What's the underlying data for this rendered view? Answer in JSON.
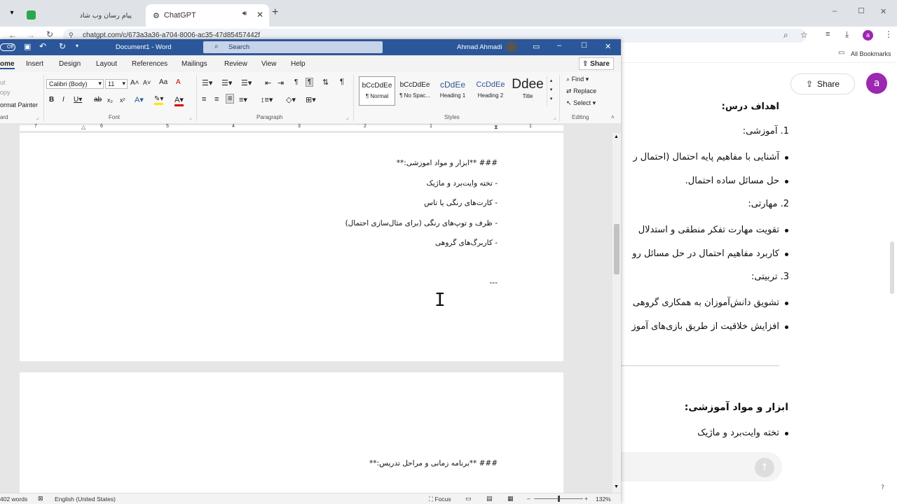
{
  "browser": {
    "tabs": [
      {
        "title": "پیام رسان وب شاد"
      },
      {
        "title": "ChatGPT"
      }
    ],
    "url": "chatgpt.com/c/673a3a36-a704-8006-ac35-47d85457442f",
    "bookmarks_label": "All Bookmarks",
    "profile_initial": "a",
    "window_controls": {
      "minimize": "–",
      "maximize": "☐",
      "close": "✕"
    }
  },
  "chatgpt": {
    "share_label": "Share",
    "avatar_initial": "a",
    "lines": {
      "goals_heading": "اهداف درس:",
      "item1": "1. آموزشی:",
      "b1": "آشنایی با مفاهیم پایه احتمال (احتمال ر",
      "b2": "حل مسائل ساده احتمال.",
      "item2": "2. مهارتی:",
      "b3": "تقویت مهارت تفکر منطقی و استدلال",
      "b4": "کاربرد مفاهیم احتمال در حل مسائل رو",
      "item3": "3. تربیتی:",
      "b5": "تشویق دانش‌آموزان به همکاری گروهی",
      "b6": "افزایش خلاقیت از طریق بازی‌های آموز",
      "tools_heading": "ابزار و مواد آموزشی:",
      "b7": "تخته وایت‌برد و ماژیک"
    },
    "help": "?"
  },
  "word": {
    "autosave": "Off",
    "doc_title": "Document1 - Word",
    "search_placeholder": "Search",
    "user_name": "Ahmad Ahmadi",
    "tabs": [
      "ome",
      "Insert",
      "Design",
      "Layout",
      "References",
      "Mailings",
      "Review",
      "View",
      "Help"
    ],
    "share_label": "Share",
    "clipboard": {
      "cut": "ut",
      "copy": "opy",
      "painter": "ormat Painter",
      "group": "ard"
    },
    "font": {
      "name": "Calibri (Body)",
      "size": "11",
      "group": "Font"
    },
    "paragraph_group": "Paragraph",
    "styles": [
      {
        "preview": "bCcDdEe",
        "name": "¶ Normal"
      },
      {
        "preview": "bCcDdEe",
        "name": "¶ No Spac..."
      },
      {
        "preview": "cDdEe",
        "name": "Heading 1"
      },
      {
        "preview": "CcDdEe",
        "name": "Heading 2"
      },
      {
        "preview": "Ddee",
        "name": "Title"
      }
    ],
    "styles_group": "Styles",
    "editing": {
      "find": "Find",
      "replace": "Replace",
      "select": "Select",
      "group": "Editing"
    },
    "ruler_numbers": [
      "7",
      "6",
      "5",
      "4",
      "3",
      "2",
      "1",
      "1"
    ],
    "doc_lines": [
      "### **ابزار و مواد اموزشی:**",
      "- تخته وایت‌برد و ماژیک",
      "- کارت‌های رنگی یا تاس",
      "- ظرف و توپ‌های رنگی (برای مثال‌سازی احتمال)",
      "- کاربرگ‌های گروهی",
      "---",
      "### **برنامه زمانی و مراحل تدریس:**"
    ],
    "status": {
      "words": "402 words",
      "language": "English (United States)",
      "focus": "Focus",
      "zoom": "132%"
    }
  }
}
